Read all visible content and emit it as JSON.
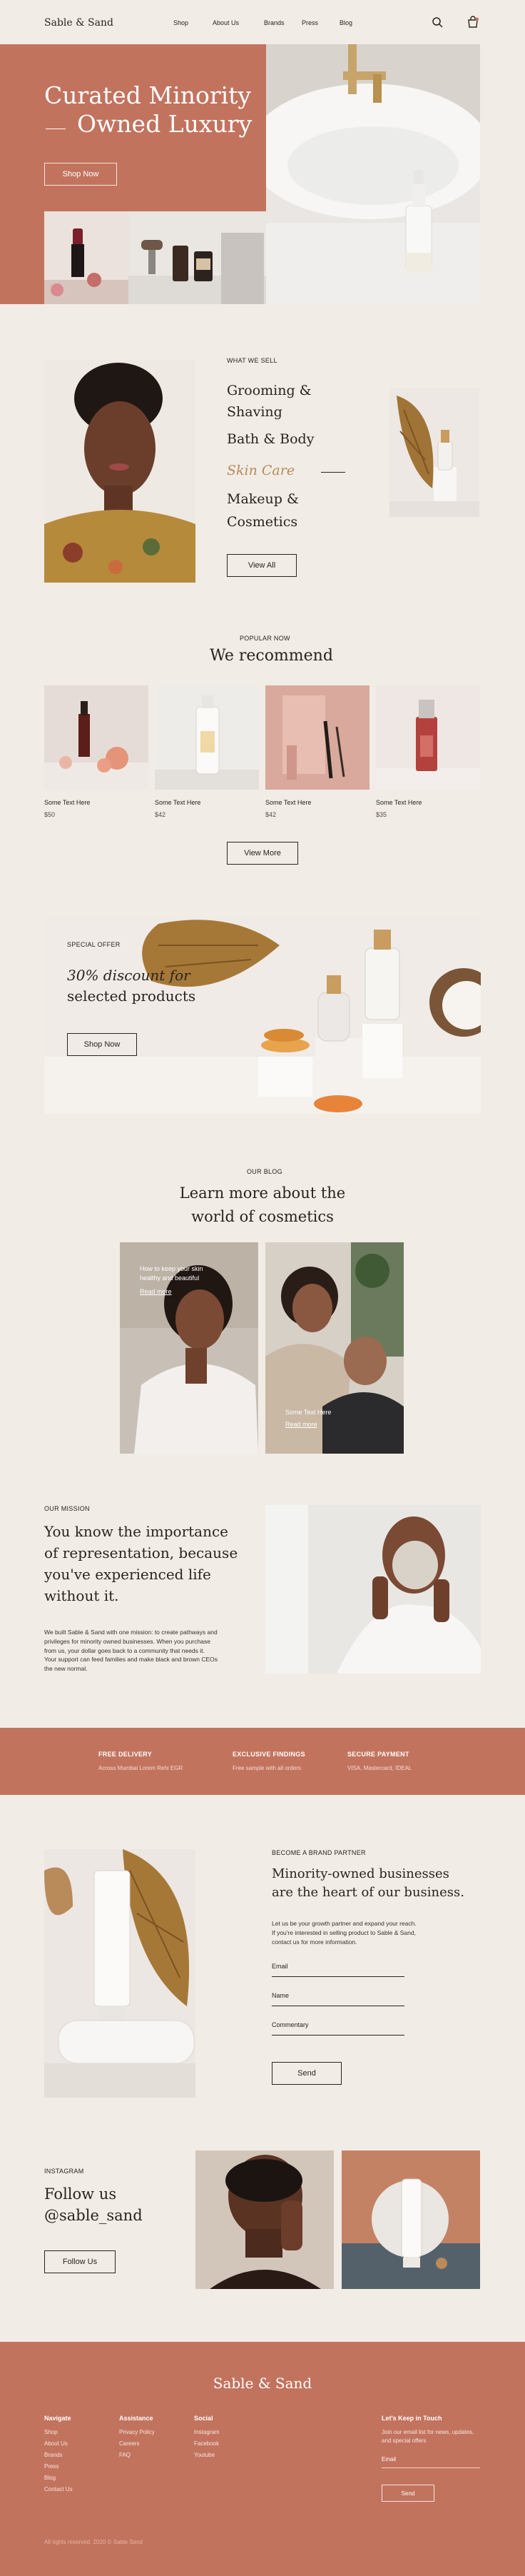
{
  "header": {
    "logo": "Sable & Sand",
    "nav": [
      "Shop",
      "About Us",
      "Brands",
      "Press",
      "Blog"
    ],
    "search_icon": "search-icon",
    "cart_icon": "cart-icon"
  },
  "hero": {
    "title_line1": "Curated Minority",
    "title_line2": "Owned Luxury",
    "cta": "Shop Now"
  },
  "what_we_sell": {
    "kicker": "WHAT WE SELL",
    "categories": [
      "Grooming &",
      "Shaving",
      "Bath & Body",
      "Skin Care",
      "Makeup &",
      "Cosmetics"
    ],
    "active_category": "Skin Care",
    "active_color": "#b98a5a",
    "cta": "View All"
  },
  "recommend": {
    "kicker": "POPULAR NOW",
    "title": "We recommend",
    "products": [
      {
        "name": "Some Text Here",
        "price": "$50"
      },
      {
        "name": "Some Text Here",
        "price": "$42"
      },
      {
        "name": "Some Text Here",
        "price": "$42"
      },
      {
        "name": "Some Text Here",
        "price": "$35"
      }
    ],
    "cta": "View More"
  },
  "offer": {
    "kicker": "SPECIAL OFFER",
    "title_line1": "30% discount for",
    "title_line2": "selected products",
    "cta": "Shop Now"
  },
  "blog": {
    "kicker": "OUR BLOG",
    "title_line1": "Learn more about the",
    "title_line2": "world of cosmetics",
    "posts": [
      {
        "title_line1": "How to keep your skin",
        "title_line2": "healthy and beautiful",
        "link": "Read more"
      },
      {
        "title_line1": "Some Text Here",
        "title_line2": "",
        "link": "Read more"
      }
    ]
  },
  "mission": {
    "kicker": "OUR MISSION",
    "title_line1": "You know the importance",
    "title_line2": "of representation, because",
    "title_line3": "you've experienced life",
    "title_line4": "without it.",
    "body_line1": "We built Sable & Sand with one mission: to create pathways and",
    "body_line2": "privileges for minority owned businesses. When you purchase",
    "body_line3": "from us, your dollar goes back to a community that needs it.",
    "body_line4": "Your support can feed families and make black and brown CEOs",
    "body_line5": "the new normal."
  },
  "features": [
    {
      "title": "FREE DELIVERY",
      "sub": "Across Mumbai Lorem Rehi EGR"
    },
    {
      "title": "EXCLUSIVE FINDINGS",
      "sub": "Free sample with all orders"
    },
    {
      "title": "SECURE PAYMENT",
      "sub": "VISA, Mastercard, IDEAL"
    }
  ],
  "partner": {
    "kicker": "BECOME A BRAND PARTNER",
    "title_line1": "Minority-owned businesses",
    "title_line2": "are the heart of our business.",
    "body_line1": "Let us be your growth partner and expand your reach.",
    "body_line2": "If you're interested in selling product to Sable & Sand,",
    "body_line3": "contact us for more information.",
    "fields": [
      "Email",
      "Name",
      "Commentary"
    ],
    "cta": "Send"
  },
  "instagram": {
    "kicker": "INSTAGRAM",
    "title_line1": "Follow us",
    "title_line2": "@sable_sand",
    "cta": "Follow Us"
  },
  "footer": {
    "logo": "Sable & Sand",
    "columns": [
      {
        "title": "Navigate",
        "links": [
          "Shop",
          "About Us",
          "Brands",
          "Press",
          "Blog",
          "Contact Us"
        ]
      },
      {
        "title": "Assistance",
        "links": [
          "Privacy Policy",
          "Careers",
          "FAQ"
        ]
      },
      {
        "title": "Social",
        "links": [
          "Instagram",
          "Facebook",
          "Youtube"
        ]
      }
    ],
    "newsletter_title": "Let's Keep in Touch",
    "newsletter_line1": "Join our email list for news, updates,",
    "newsletter_line2": "and special offers",
    "email_label": "Email",
    "send": "Send",
    "copyright": "All rights reserved. 2020 © Sable Sand"
  },
  "colors": {
    "brand": "#c2735e",
    "background": "#f1ece6",
    "text": "#2a2320",
    "accent_gold": "#b98a5a"
  }
}
